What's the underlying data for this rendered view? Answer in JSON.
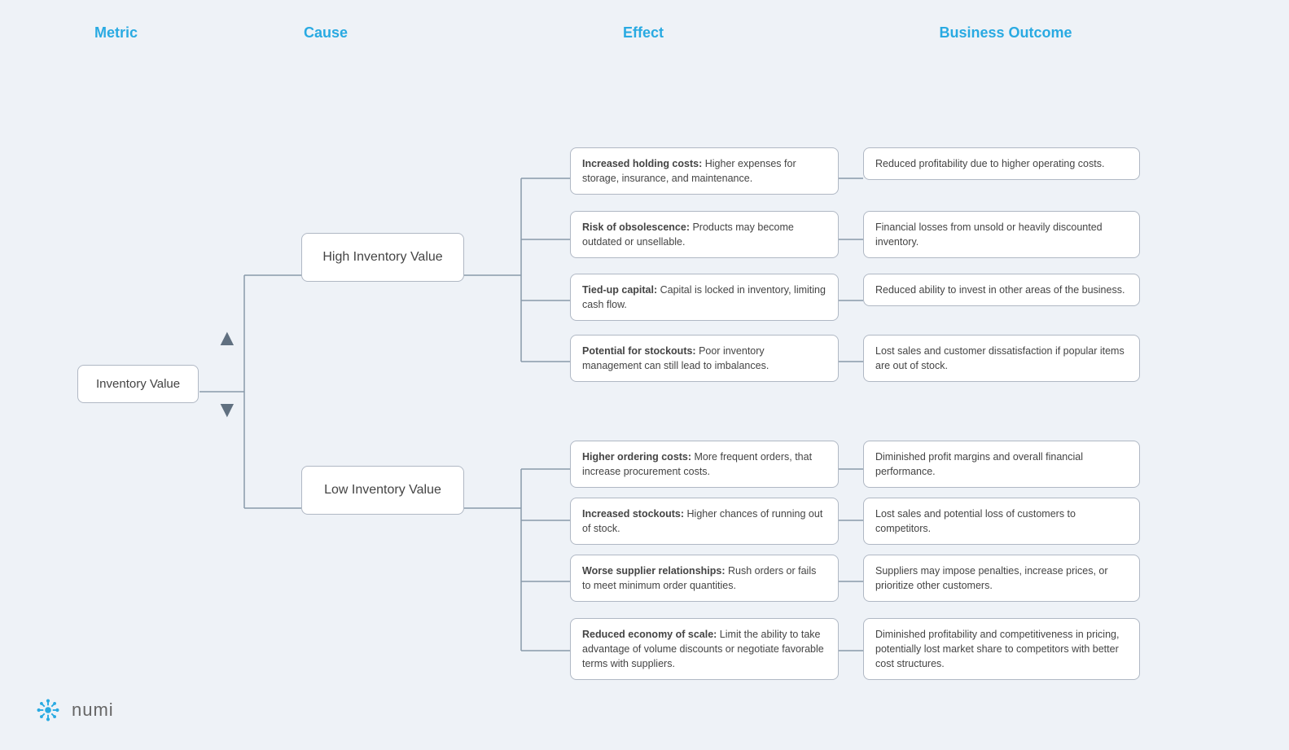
{
  "header": {
    "col_metric": "Metric",
    "col_cause": "Cause",
    "col_effect": "Effect",
    "col_outcome": "Business Outcome"
  },
  "metric": {
    "label": "Inventory Value"
  },
  "causes": {
    "high": "High Inventory Value",
    "low": "Low Inventory Value"
  },
  "high_effects": [
    {
      "label": "Increased holding costs: Higher expenses for storage, insurance, and maintenance.",
      "bold": "Increased holding costs:"
    },
    {
      "label": "Risk of obsolescence: Products may become outdated or unsellable.",
      "bold": "Risk of obsolescence:"
    },
    {
      "label": "Tied-up capital: Capital is locked in inventory, limiting cash flow.",
      "bold": "Tied-up capital:"
    },
    {
      "label": "Potential for stockouts: Poor inventory management can still lead to imbalances.",
      "bold": "Potential for stockouts:"
    }
  ],
  "high_outcomes": [
    "Reduced profitability due to higher operating costs.",
    "Financial losses from unsold or heavily discounted inventory.",
    "Reduced ability to invest in other areas of the business.",
    "Lost sales and customer dissatisfaction if popular items are out of stock."
  ],
  "low_effects": [
    {
      "label": "Higher ordering costs: More frequent orders, that increase procurement costs.",
      "bold": "Higher ordering costs:"
    },
    {
      "label": "Increased stockouts: Higher chances of running out of stock.",
      "bold": "Increased stockouts:"
    },
    {
      "label": "Worse supplier relationships: Rush orders or fails to meet minimum order quantities.",
      "bold": "Worse supplier relationships:"
    },
    {
      "label": "Reduced economy of scale: Limit the ability to take advantage of volume discounts or negotiate favorable terms with suppliers.",
      "bold": "Reduced economy of scale:"
    }
  ],
  "low_outcomes": [
    "Diminished profit margins and overall financial performance.",
    "Lost sales and potential loss of customers to competitors.",
    "Suppliers may impose penalties, increase prices, or prioritize other customers.",
    "Diminished profitability and competitiveness in pricing, potentially lost market share to competitors with better cost structures."
  ],
  "logo": {
    "text": "numi"
  }
}
